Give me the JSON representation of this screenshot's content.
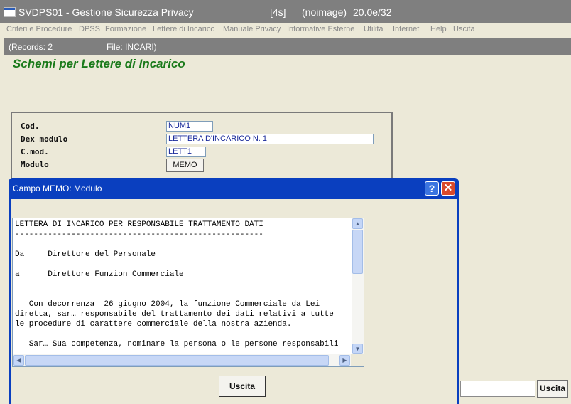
{
  "window": {
    "title": "SVDPS01 - Gestione Sicurezza Privacy",
    "timer": "[4s]",
    "image_status": "(noimage)",
    "version": "20.0e/32"
  },
  "menu": [
    "Criteri e Procedure",
    "DPSS",
    "Formazione",
    "Lettere di Incarico",
    "Manuale Privacy",
    "Informative Esterne",
    "Utilita'",
    "Internet",
    "Help",
    "Uscita"
  ],
  "form_header": {
    "records": "(Records: 2",
    "file": "File: INCARI)"
  },
  "page_title": "Schemi per Lettere di Incarico",
  "form": {
    "cod_label": "Cod.",
    "cod_value": "NUM1",
    "dex_label": "Dex modulo",
    "dex_value": "LETTERA D'INCARICO N. 1",
    "cmod_label": "C.mod.",
    "cmod_value": "LETT1",
    "modulo_label": "Modulo",
    "memo_button": "MEMO"
  },
  "main_exit_button": "Uscita",
  "dialog": {
    "title": "Campo MEMO: Modulo",
    "help_glyph": "?",
    "close_glyph": "✕",
    "memo_lines": [
      "LETTERA DI INCARICO PER RESPONSABILE TRATTAMENTO DATI",
      "-----------------------------------------------------",
      "",
      "Da     Direttore del Personale",
      "",
      "a      Direttore Funzion Commerciale",
      "",
      "",
      "   Con decorrenza  26 giugno 2004, la funzione Commerciale da Lei",
      "diretta, sar… responsabile del trattamento dei dati relativi a tutte",
      "le procedure di carattere commerciale della nostra azienda.",
      "",
      "   Sar… Sua competenza, nominare la persona o le persone responsabili"
    ],
    "exit_button": "Uscita",
    "scroll_up": "▲",
    "scroll_down": "▼",
    "scroll_left": "◀",
    "scroll_right": "▶"
  },
  "colors": {
    "title_green": "#1a7a1a",
    "dialog_blue": "#0a3fbf",
    "inactive_title": "#7f7f7f",
    "field_text": "#1a2a9a"
  }
}
